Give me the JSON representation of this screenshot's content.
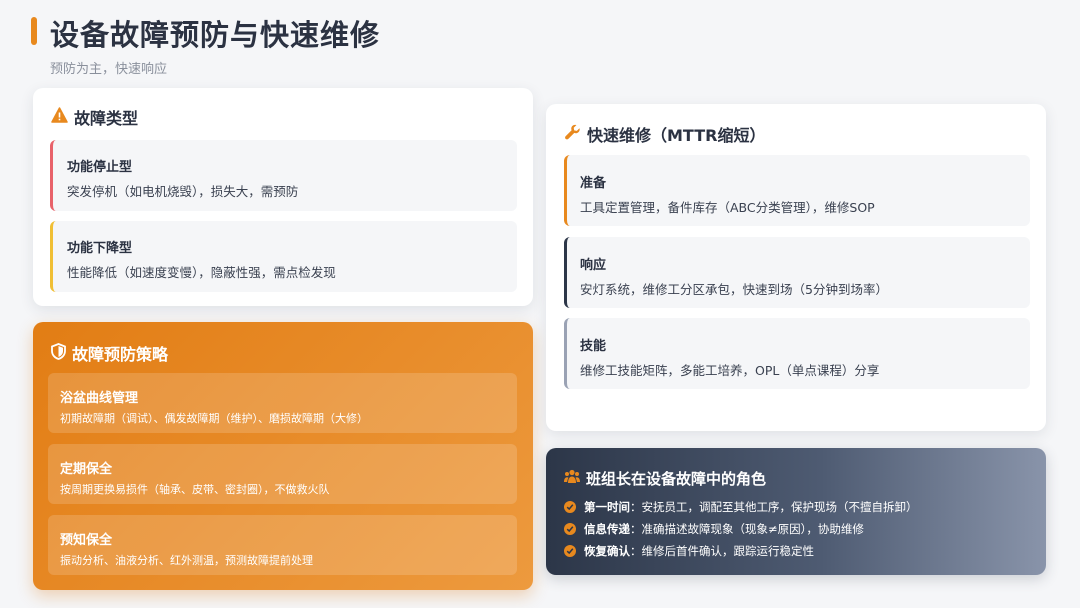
{
  "header": {
    "title": "设备故障预防与快速维修",
    "subtitle": "预防为主，快速响应"
  },
  "colors": {
    "accent": "#e8891e",
    "red": "#e8626a",
    "yellow": "#f0bf35",
    "navy": "#2c3648",
    "gray": "#9aa2b4"
  },
  "fault_types": {
    "title": "故障类型",
    "icon": "warning-icon",
    "items": [
      {
        "title": "功能停止型",
        "desc": "突发停机（如电机烧毁），损失大，需预防"
      },
      {
        "title": "功能下降型",
        "desc": "性能降低（如速度变慢），隐蔽性强，需点检发现"
      }
    ]
  },
  "prevention": {
    "title": "故障预防策略",
    "icon": "shield-icon",
    "items": [
      {
        "title": "浴盆曲线管理",
        "desc": "初期故障期（调试）、偶发故障期（维护）、磨损故障期（大修）"
      },
      {
        "title": "定期保全",
        "desc": "按周期更换易损件（轴承、皮带、密封圈），不做救火队"
      },
      {
        "title": "预知保全",
        "desc": "振动分析、油液分析、红外测温，预测故障提前处理"
      }
    ]
  },
  "quick_repair": {
    "title": "快速维修（MTTR缩短）",
    "icon": "wrench-icon",
    "items": [
      {
        "title": "准备",
        "desc": "工具定置管理，备件库存（ABC分类管理），维修SOP"
      },
      {
        "title": "响应",
        "desc": "安灯系统，维修工分区承包，快速到场（5分钟到场率）"
      },
      {
        "title": "技能",
        "desc": "维修工技能矩阵，多能工培养，OPL（单点课程）分享"
      }
    ]
  },
  "leader": {
    "title": "班组长在设备故障中的角色",
    "icon": "team-icon",
    "rows": [
      {
        "label": "第一时间",
        "text": "：安抚员工，调配至其他工序，保护现场（不擅自拆卸）"
      },
      {
        "label": "信息传递",
        "text": "：准确描述故障现象（现象≠原因），协助维修"
      },
      {
        "label": "恢复确认",
        "text": "：维修后首件确认，跟踪运行稳定性"
      }
    ]
  }
}
